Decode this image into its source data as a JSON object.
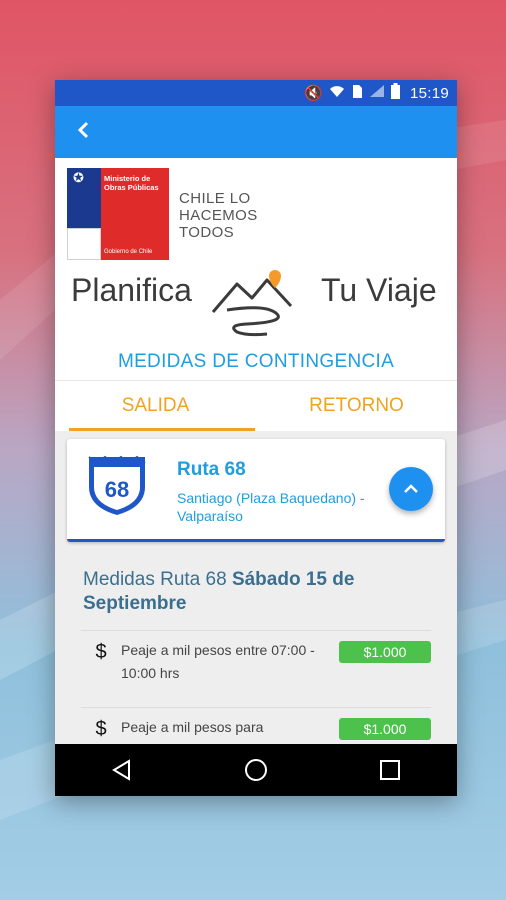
{
  "status_bar": {
    "time": "15:19",
    "icons": [
      "mute-icon",
      "wifi-icon",
      "sim-icon",
      "signal-icon",
      "battery-icon"
    ]
  },
  "toolbar": {
    "back_icon": "chevron-left-icon"
  },
  "brand": {
    "logo_title": "Ministerio de Obras Públicas",
    "logo_sub": "Gobierno de Chile",
    "slogan_lines": [
      "CHILE LO",
      "HACEMOS",
      "TODOS"
    ]
  },
  "header": {
    "word1": "Planifica",
    "word2": "Tu Viaje"
  },
  "contingencia": "MEDIDAS DE CONTINGENCIA",
  "tabs": [
    {
      "label": "SALIDA",
      "active": true
    },
    {
      "label": "RETORNO",
      "active": false
    }
  ],
  "route": {
    "number": "68",
    "name": "Ruta 68",
    "description": "Santiago (Plaza Baquedano) - Valparaíso"
  },
  "medidas": {
    "prefix": "Medidas Ruta 68",
    "date": "Sábado 15 de Septiembre",
    "items": [
      {
        "icon": "$",
        "text": "Peaje a mil pesos entre 07:00 - 10:00 hrs",
        "price": "$1.000"
      },
      {
        "icon": "$",
        "text": "Peaje a mil pesos para",
        "price": "$1.000"
      }
    ]
  },
  "colors": {
    "statusbar": "#1f57c8",
    "toolbar": "#1e90f0",
    "accent": "#f0a322",
    "route": "#1e9ee0",
    "price": "#4cc24c"
  }
}
